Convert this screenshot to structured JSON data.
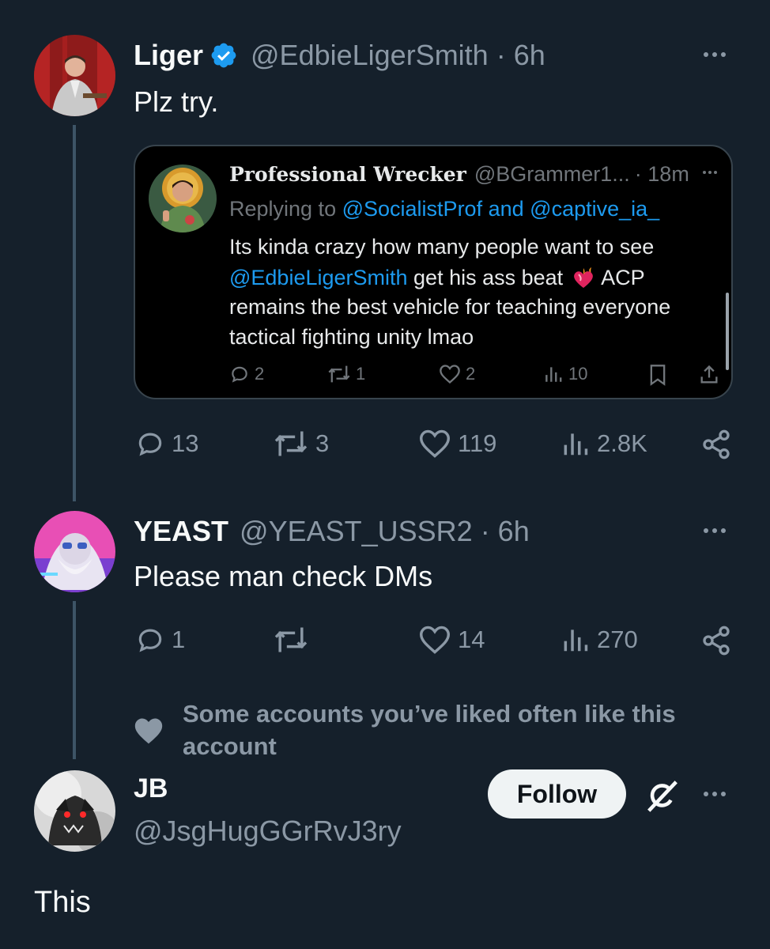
{
  "tweet1": {
    "name": "Liger",
    "handle": "@EdbieLigerSmith",
    "time": "· 6h",
    "text": "Plz try.",
    "quote": {
      "name": "Professional Wrecker",
      "handle": "@BGrammer1...",
      "time": "· 18m",
      "replying_prefix": "Replying to",
      "replying_to_1": "@SocialistProf",
      "replying_and": "and",
      "replying_to_2": "@captive_ia_",
      "line1": "Its kinda crazy how many people want to see",
      "mention": "@EdbieLigerSmith",
      "line2_rest": " get his ass beat",
      "line2_after_emoji": " ACP",
      "line3": "remains the best vehicle for teaching everyone",
      "line4": "tactical fighting unity lmao",
      "replies": "2",
      "reposts": "1",
      "likes": "2",
      "views": "10"
    },
    "replies": "13",
    "reposts": "3",
    "likes": "119",
    "views": "2.8K"
  },
  "tweet2": {
    "name": "YEAST",
    "handle": "@YEAST_USSR2",
    "time": "· 6h",
    "text": "Please man check DMs",
    "replies": "1",
    "likes": "14",
    "views": "270"
  },
  "social_context": {
    "line1": "Some accounts you’ve liked often like this",
    "line2": "account"
  },
  "tweet3": {
    "name": "JB",
    "handle": "@JsgHugGGrRvJ3ry",
    "follow_label": "Follow",
    "text": "This"
  },
  "colors": {
    "background": "#15202b",
    "muted": "#8b98a5",
    "link": "#1d9bf0",
    "verified": "#1d9bf0"
  }
}
